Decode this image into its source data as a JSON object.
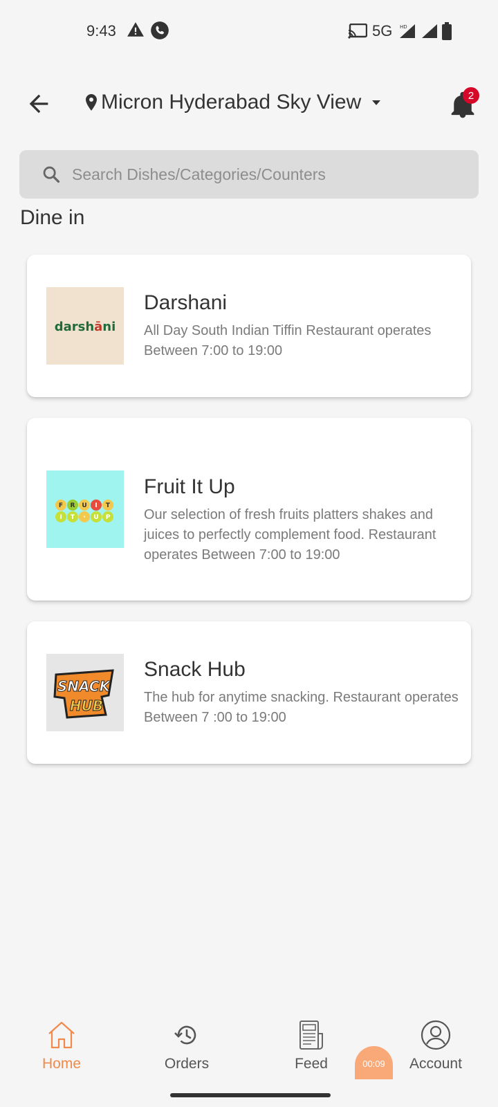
{
  "status_bar": {
    "time": "9:43",
    "network": "5G",
    "icons": [
      "warning-icon",
      "phone-call-icon",
      "cast-icon",
      "signal-icon",
      "signal-icon",
      "battery-icon"
    ]
  },
  "header": {
    "location": "Micron Hyderabad Sky View",
    "notification_count": "2"
  },
  "search": {
    "placeholder": "Search Dishes/Categories/Counters"
  },
  "section": {
    "title": "Dine in"
  },
  "restaurants": [
    {
      "name": "Darshani",
      "description": "All Day South Indian Tiffin Restaurant operates Between 7:00 to 19:00",
      "logo_text": "darshāni",
      "logo_bg": "#f1e2cf"
    },
    {
      "name": "Fruit It Up",
      "description": "Our selection of fresh fruits platters shakes and juices to perfectly complement food. Restaurant operates Between 7:00 to 19:00",
      "logo_text": "FRUIT IT UP",
      "logo_bg": "#9ff4f0"
    },
    {
      "name": "Snack Hub",
      "description": "The hub for anytime snacking. Restaurant operates Between 7 :00 to 19:00",
      "logo_text": "SNACK HUB",
      "logo_bg": "#e6e6e6"
    }
  ],
  "bottom_nav": {
    "items": [
      {
        "label": "Home",
        "icon": "home-icon",
        "active": true
      },
      {
        "label": "Orders",
        "icon": "history-icon",
        "active": false
      },
      {
        "label": "Feed",
        "icon": "newspaper-icon",
        "active": false
      },
      {
        "label": "Account",
        "icon": "user-circle-icon",
        "active": false
      }
    ],
    "timer": "00:09"
  },
  "colors": {
    "accent": "#f08a4b",
    "badge": "#d6082a",
    "background": "#f5f5f5"
  }
}
